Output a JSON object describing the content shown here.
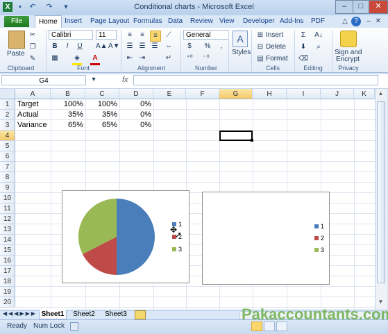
{
  "window": {
    "title": "Conditional charts - Microsoft Excel"
  },
  "tabs": [
    "File",
    "Home",
    "Insert",
    "Page Layout",
    "Formulas",
    "Data",
    "Review",
    "View",
    "Developer",
    "Add-Ins",
    "PDF"
  ],
  "ribbon": {
    "clipboard": {
      "label": "Clipboard",
      "paste": "Paste"
    },
    "font": {
      "label": "Font",
      "name": "Calibri",
      "size": "11",
      "bold": "B",
      "italic": "I",
      "underline": "U"
    },
    "alignment": {
      "label": "Alignment"
    },
    "number": {
      "label": "Number",
      "format": "General",
      "currency": "$",
      "percent": "%"
    },
    "styles": {
      "label": "Styles"
    },
    "cells": {
      "label": "Cells",
      "insert": "Insert",
      "delete": "Delete",
      "format": "Format"
    },
    "editing": {
      "label": "Editing"
    },
    "privacy": {
      "label": "Privacy",
      "sign": "Sign and",
      "encrypt": "Encrypt"
    }
  },
  "formula_bar": {
    "name_box": "G4",
    "fx": "fx",
    "formula": ""
  },
  "columns": [
    "A",
    "B",
    "C",
    "D",
    "E",
    "F",
    "G",
    "H",
    "I",
    "J",
    "K"
  ],
  "rows": [
    "1",
    "2",
    "3",
    "4",
    "5",
    "6",
    "7",
    "8",
    "9",
    "10",
    "11",
    "12",
    "13",
    "14",
    "15",
    "16",
    "17",
    "18",
    "19",
    "20"
  ],
  "cells": {
    "a1": "Target",
    "b1": "100%",
    "c1": "100%",
    "d1": "0%",
    "a2": "Actual",
    "b2": "35%",
    "c2": "35%",
    "d2": "0%",
    "a3": "Variance",
    "b3": "65%",
    "c3": "65%",
    "d3": "0%"
  },
  "chart_data": [
    {
      "type": "pie",
      "categories": [
        "1",
        "2",
        "3"
      ],
      "values": [
        50,
        17.5,
        32.5
      ],
      "colors": [
        "#4a7ebb",
        "#be4b48",
        "#98b954"
      ],
      "legend": "right"
    },
    {
      "type": "pie",
      "categories": [
        "1",
        "2",
        "3"
      ],
      "values": [
        0,
        0,
        0
      ],
      "colors": [
        "#4a7ebb",
        "#be4b48",
        "#98b954"
      ],
      "legend": "right"
    }
  ],
  "sheets": [
    "Sheet1",
    "Sheet2",
    "Sheet3"
  ],
  "status": {
    "ready": "Ready",
    "numlock": "Num Lock"
  },
  "watermark": "Pakaccountants.com"
}
